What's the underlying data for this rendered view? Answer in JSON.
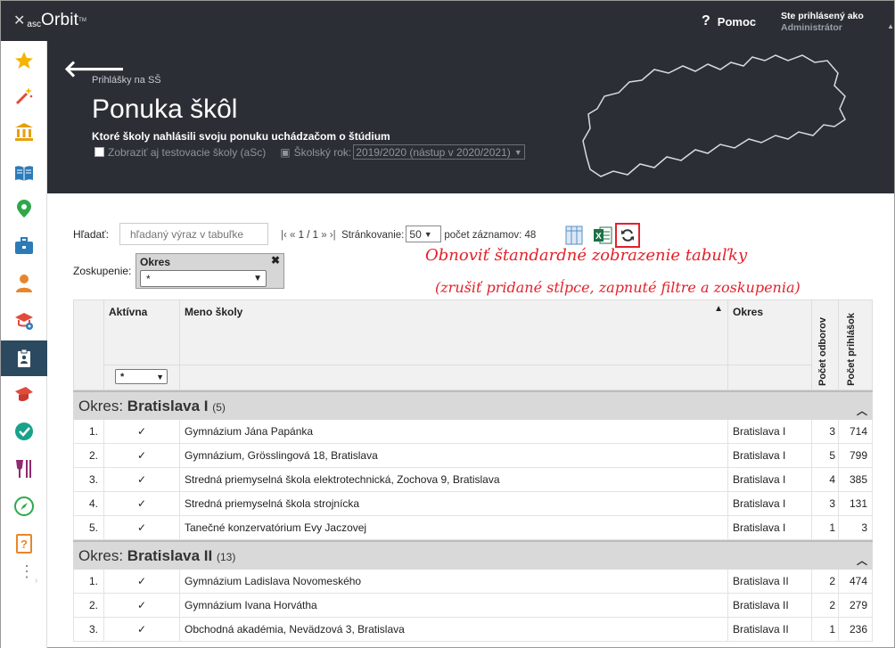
{
  "app": {
    "logo_asc": "asc",
    "logo_orbit": "Orbit",
    "logo_tm": "TM",
    "help_label": "Pomoc",
    "user_line1": "Ste prihlásený ako",
    "user_line2": "Administrátor"
  },
  "sidebar": {
    "items": [
      {
        "name": "star",
        "color": "#f4b400"
      },
      {
        "name": "magic-wand",
        "color": "#e14b3c"
      },
      {
        "name": "institution",
        "color": "#e6a00a"
      },
      {
        "name": "book",
        "color": "#2b7bb9"
      },
      {
        "name": "map-pin",
        "color": "#2ea84a"
      },
      {
        "name": "briefcase",
        "color": "#2b7bb9"
      },
      {
        "name": "student",
        "color": "#e8862a"
      },
      {
        "name": "school-gear",
        "color": "#e14b3c"
      },
      {
        "name": "applications",
        "color": "#ffffff"
      },
      {
        "name": "graduation-cap",
        "color": "#e14b3c"
      },
      {
        "name": "check-circle",
        "color": "#19a28a"
      },
      {
        "name": "dining",
        "color": "#8e2a6f"
      },
      {
        "name": "compass",
        "color": "#2ea84a"
      },
      {
        "name": "question-book",
        "color": "#e8862a"
      }
    ]
  },
  "header": {
    "breadcrumb": "Prihlášky na SŠ",
    "title": "Ponuka škôl",
    "subtitle": "Ktoré školy nahlásili svoju ponuku uchádzačom o štúdium",
    "show_test_label": "Zobraziť aj testovacie školy (aSc)",
    "year_label": "Školský rok:",
    "year_value": "2019/2020 (nástup v 2020/2021)"
  },
  "toolbar": {
    "search_label": "Hľadať:",
    "search_placeholder": "hľadaný výraz v tabuľke",
    "pager_first": "|‹",
    "pager_prev": "«",
    "pager_pages": "1 / 1",
    "pager_next": "»",
    "pager_last": "›|",
    "paging_label": "Stránkovanie:",
    "paging_value": "50",
    "records_label": "počet záznamov: 48",
    "group_label": "Zoskupenie:",
    "group_box_title": "Okres",
    "group_select_value": "*"
  },
  "annotation": {
    "line1": "Obnoviť štandardné zobrazenie tabuľky",
    "line2": "(zrušiť pridané stĺpce, zapnuté filtre a zoskupenia)"
  },
  "table": {
    "columns": {
      "active": "Aktívna",
      "name": "Meno školy",
      "okres": "Okres",
      "odbory": "Počet odborov",
      "prihlasky": "Počet prihlášok"
    },
    "active_filter": "*",
    "groups": [
      {
        "label": "Okres:",
        "name": "Bratislava I",
        "count": "(5)",
        "rows": [
          {
            "num": "1.",
            "active": "✓",
            "name": "Gymnázium Jána Papánka",
            "okres": "Bratislava I",
            "odbory": "3",
            "prihlasky": "714"
          },
          {
            "num": "2.",
            "active": "✓",
            "name": "Gymnázium, Grösslingová 18, Bratislava",
            "okres": "Bratislava I",
            "odbory": "5",
            "prihlasky": "799"
          },
          {
            "num": "3.",
            "active": "✓",
            "name": "Stredná priemyselná škola elektrotechnická, Zochova 9, Bratislava",
            "okres": "Bratislava I",
            "odbory": "4",
            "prihlasky": "385"
          },
          {
            "num": "4.",
            "active": "✓",
            "name": "Stredná priemyselná škola strojnícka",
            "okres": "Bratislava I",
            "odbory": "3",
            "prihlasky": "131"
          },
          {
            "num": "5.",
            "active": "✓",
            "name": "Tanečné konzervatórium Evy Jaczovej",
            "okres": "Bratislava I",
            "odbory": "1",
            "prihlasky": "3"
          }
        ]
      },
      {
        "label": "Okres:",
        "name": "Bratislava II",
        "count": "(13)",
        "rows": [
          {
            "num": "1.",
            "active": "✓",
            "name": "Gymnázium Ladislava Novomeského",
            "okres": "Bratislava II",
            "odbory": "2",
            "prihlasky": "474"
          },
          {
            "num": "2.",
            "active": "✓",
            "name": "Gymnázium Ivana Horvátha",
            "okres": "Bratislava II",
            "odbory": "2",
            "prihlasky": "279"
          },
          {
            "num": "3.",
            "active": "✓",
            "name": "Obchodná akadémia, Nevädzová 3, Bratislava",
            "okres": "Bratislava II",
            "odbory": "1",
            "prihlasky": "236"
          }
        ]
      }
    ]
  },
  "colors": {
    "header_bg": "#2b2f35",
    "annotation_red": "#e2222b",
    "group_row_bg": "#d9d9d9"
  }
}
